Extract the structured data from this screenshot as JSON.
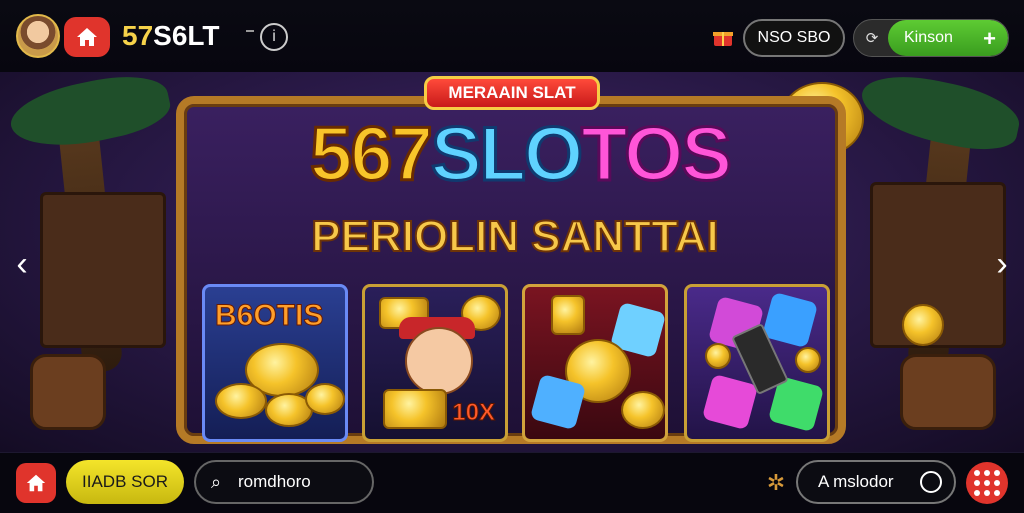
{
  "header": {
    "title_main": "57",
    "title_rest": "S6LT",
    "info_symbol": "i",
    "center_pill": "NSO SBO",
    "login_label": "Kinson",
    "plus_symbol": "+"
  },
  "banner": {
    "ribbon": "MERAAIN SLAT",
    "title_part1": "567",
    "title_part2": "SLO",
    "title_part3": "TOS",
    "subtitle": "PERIOLIN SANTTAI",
    "prev_arrow": "‹",
    "next_arrow": "›"
  },
  "games": [
    {
      "label": "B6OTIS"
    },
    {
      "label": "10X"
    },
    {
      "label": ""
    },
    {
      "label": ""
    }
  ],
  "footer": {
    "yellow_button": "IIADB SOR",
    "search_value": "romdhoro",
    "account_label": "A mslodor"
  },
  "colors": {
    "accent_red": "#e0342c",
    "accent_green": "#4cb528",
    "accent_yellow": "#f4e52a",
    "gold": "#f8c52a"
  }
}
